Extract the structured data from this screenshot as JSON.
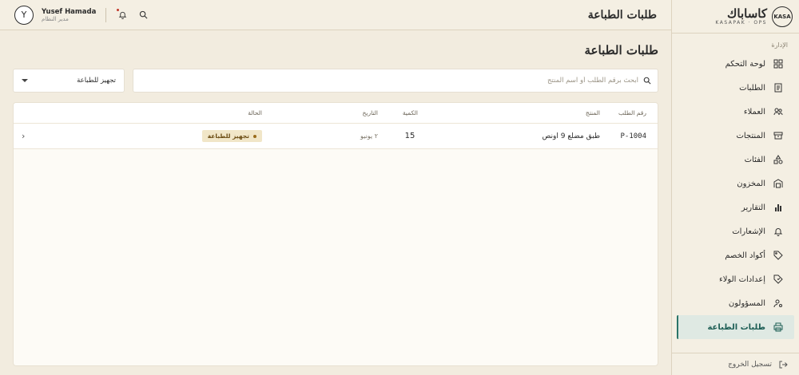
{
  "brand": {
    "badge": "KASA",
    "name": "كاساباك",
    "subtitle": "KASAPAK · OPS"
  },
  "sidebar": {
    "section_label": "الإدارة",
    "items": [
      {
        "label": "لوحة التحكم",
        "icon": "dashboard-icon"
      },
      {
        "label": "الطلبات",
        "icon": "orders-icon"
      },
      {
        "label": "العملاء",
        "icon": "users-icon"
      },
      {
        "label": "المنتجات",
        "icon": "box-icon"
      },
      {
        "label": "الفئات",
        "icon": "shapes-icon"
      },
      {
        "label": "المخزون",
        "icon": "warehouse-icon"
      },
      {
        "label": "التقارير",
        "icon": "chart-icon"
      },
      {
        "label": "الإشعارات",
        "icon": "bell-icon"
      },
      {
        "label": "أكواد الخصم",
        "icon": "tag-icon"
      },
      {
        "label": "إعدادات الولاء",
        "icon": "loyalty-icon"
      },
      {
        "label": "المسؤولون",
        "icon": "admins-icon"
      },
      {
        "label": "طلبات الطباعة",
        "icon": "printer-icon",
        "active": true
      }
    ],
    "logout_label": "تسجيل الخروج"
  },
  "topbar": {
    "title": "طلبات الطباعة",
    "user_name": "Yusef Hamada",
    "user_role": "مدير النظام",
    "avatar_initial": "Y"
  },
  "main": {
    "page_title": "طلبات الطباعة",
    "search_placeholder": "ابحث برقم الطلب أو اسم المنتج",
    "status_filter": "تجهيز للطباعة",
    "table": {
      "headers": {
        "order": "رقم الطلب",
        "product": "المنتج",
        "qty": "الكمية",
        "date": "التاريخ",
        "status": "الحالة"
      },
      "rows": [
        {
          "order": "P-1004",
          "product": "طبق مضلع 9 اونص",
          "qty": "15",
          "date": "٢ يونيو",
          "status": "تجهيز للطباعة",
          "chevron": "‹"
        }
      ]
    }
  },
  "colors": {
    "accent": "#2a7468",
    "status_bg": "#f1e6c8",
    "background": "#f2ecdf"
  }
}
